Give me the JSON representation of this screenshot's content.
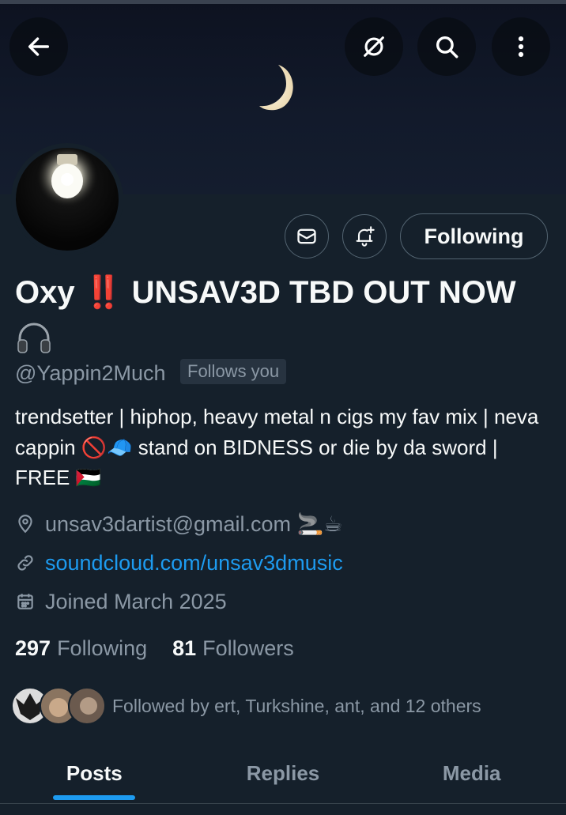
{
  "header": {
    "back_icon": "arrow-left-icon",
    "grok_icon": "grok-icon",
    "search_icon": "search-icon",
    "more_icon": "more-vertical-icon"
  },
  "profile": {
    "display_name": "Oxy",
    "name_emoji": "‼️",
    "name_rest": "UNSAV3D TBD OUT NOW",
    "name_second_line_emoji_icon": "headphones-icon",
    "handle": "@Yappin2Much",
    "follows_you_label": "Follows you",
    "bio": "trendsetter | hiphop, heavy metal n cigs my fav mix | neva cappin 🚫🧢 stand on BIDNESS or die by da sword | FREE 🇵🇸",
    "location": "unsav3dartist@gmail.com 🚬☕",
    "website": "soundcloud.com/unsav3dmusic",
    "joined": "Joined March 2025",
    "following_count": "297",
    "following_label": "Following",
    "followers_count": "81",
    "followers_label": "Followers",
    "followed_by": "Followed by ert, Turkshine, ant, and 12 others"
  },
  "actions": {
    "message_icon": "envelope-icon",
    "notify_icon": "bell-plus-icon",
    "following_button_label": "Following"
  },
  "tabs": [
    {
      "label": "Posts",
      "active": true
    },
    {
      "label": "Replies",
      "active": false
    },
    {
      "label": "Media",
      "active": false
    }
  ],
  "colors": {
    "background": "#15202b",
    "accent": "#1d9bf0",
    "secondary_text": "#8b98a5",
    "alert_red": "#e0245e"
  }
}
